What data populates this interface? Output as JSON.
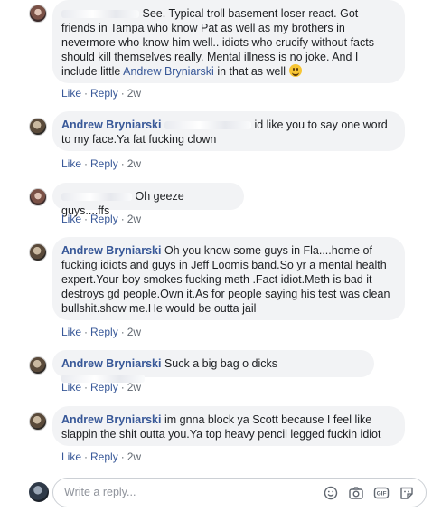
{
  "comments": [
    {
      "author": "",
      "text_before": "See. Typical troll basement loser react. Got friends in Tampa who know Pat as well as my brothers in nevermore who know him well.. idiots who crucify without facts should kill themselves really. Mental illness is no joke. And I include little ",
      "mention": "Andrew Bryniarski",
      "text_after": " in that as well",
      "emoji": "smile-emoji",
      "actions": {
        "like": "Like",
        "reply": "Reply",
        "time": "2w"
      }
    },
    {
      "author": "Andrew Bryniarski",
      "text": "id like you to say one word to my face.Ya fat fucking clown",
      "actions": {
        "like": "Like",
        "reply": "Reply",
        "time": "2w"
      }
    },
    {
      "author": "",
      "text": "Oh geeze guys....ffs",
      "actions": {
        "like": "Like",
        "reply": "Reply",
        "time": "2w"
      }
    },
    {
      "author": "Andrew Bryniarski",
      "text": "Oh you know some guys in Fla....home of fucking idiots and guys in Jeff Loomis band.So yr a mental health expert.Your boy smokes fucking meth .Fact idiot.Meth is bad it destroys gd people.Own it.As for people saying his test was clean bullshit.show me.He would be outta jail",
      "actions": {
        "like": "Like",
        "reply": "Reply",
        "time": "2w"
      }
    },
    {
      "author": "Andrew Bryniarski",
      "text": "Suck a big bag o dicks",
      "actions": {
        "like": "Like",
        "reply": "Reply",
        "time": "2w"
      }
    },
    {
      "author": "Andrew Bryniarski",
      "text": "im gnna block ya Scott because I feel like slappin the shit outta you.Ya top heavy pencil legged fuckin idiot",
      "actions": {
        "like": "Like",
        "reply": "Reply",
        "time": "2w"
      }
    }
  ],
  "reply_box": {
    "placeholder": "Write a reply...",
    "icons": [
      "emoji-icon",
      "camera-icon",
      "gif-icon",
      "sticker-icon"
    ]
  },
  "colors": {
    "link": "#385898",
    "bubble": "#f2f3f5",
    "meta": "#606770"
  }
}
